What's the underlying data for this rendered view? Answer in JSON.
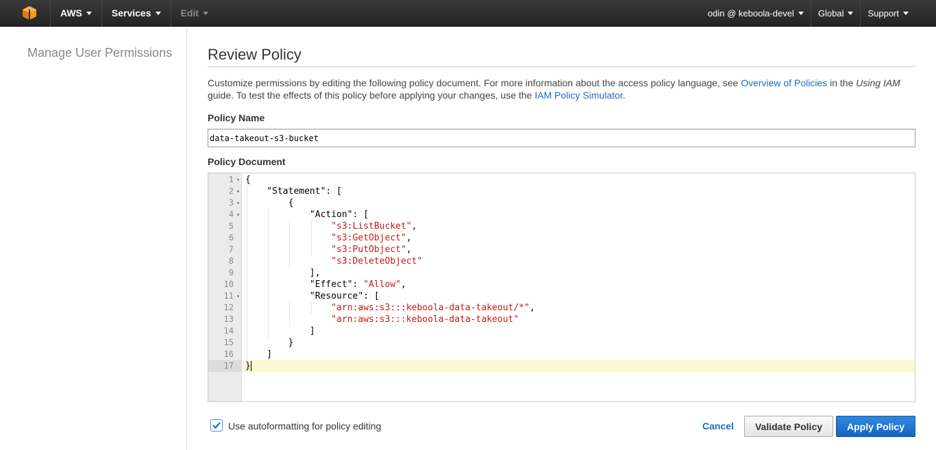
{
  "topbar": {
    "aws_label": "AWS",
    "services_label": "Services",
    "edit_label": "Edit",
    "account_label": "odin @ keboola-devel",
    "region_label": "Global",
    "support_label": "Support",
    "logo_color": "#f7981d"
  },
  "sidebar": {
    "title": "Manage User Permissions"
  },
  "main": {
    "title": "Review Policy",
    "desc_part1": "Customize permissions by editing the following policy document. For more information about the access policy language, see ",
    "desc_link1": "Overview of Policies",
    "desc_part2": " in the ",
    "desc_italic": "Using IAM",
    "desc_part3": " guide. To test the effects of this policy before applying your changes, use the ",
    "desc_link2": "IAM Policy Simulator",
    "desc_part4": ".",
    "policy_name_label": "Policy Name",
    "policy_name_value": "data-takeout-s3-bucket",
    "policy_doc_label": "Policy Document",
    "autoformat_label": "Use autoformatting for policy editing",
    "autoformat_checked": true,
    "cancel_label": "Cancel",
    "validate_label": "Validate Policy",
    "apply_label": "Apply Policy"
  },
  "editor": {
    "active_line": 17,
    "lines": [
      {
        "n": "1",
        "fold": true,
        "text": "{"
      },
      {
        "n": "2",
        "fold": true,
        "text": "    \"Statement\": ["
      },
      {
        "n": "3",
        "fold": true,
        "text": "        {"
      },
      {
        "n": "4",
        "fold": true,
        "text": "            \"Action\": ["
      },
      {
        "n": "5",
        "fold": false,
        "text": "                \"s3:ListBucket\","
      },
      {
        "n": "6",
        "fold": false,
        "text": "                \"s3:GetObject\","
      },
      {
        "n": "7",
        "fold": false,
        "text": "                \"s3:PutObject\","
      },
      {
        "n": "8",
        "fold": false,
        "text": "                \"s3:DeleteObject\""
      },
      {
        "n": "9",
        "fold": false,
        "text": "            ],"
      },
      {
        "n": "10",
        "fold": false,
        "text": "            \"Effect\": \"Allow\","
      },
      {
        "n": "11",
        "fold": true,
        "text": "            \"Resource\": ["
      },
      {
        "n": "12",
        "fold": false,
        "text": "                \"arn:aws:s3:::keboola-data-takeout/*\","
      },
      {
        "n": "13",
        "fold": false,
        "text": "                \"arn:aws:s3:::keboola-data-takeout\""
      },
      {
        "n": "14",
        "fold": false,
        "text": "            ]"
      },
      {
        "n": "15",
        "fold": false,
        "text": "        }"
      },
      {
        "n": "16",
        "fold": false,
        "text": "    ]"
      },
      {
        "n": "17",
        "fold": false,
        "text": "}"
      }
    ]
  }
}
